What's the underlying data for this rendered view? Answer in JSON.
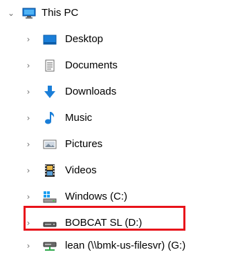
{
  "tree": {
    "root": {
      "label": "This PC",
      "icon": "monitor-icon",
      "expanded": true
    },
    "items": [
      {
        "label": "Desktop",
        "icon": "desktop-folder-icon"
      },
      {
        "label": "Documents",
        "icon": "documents-icon"
      },
      {
        "label": "Downloads",
        "icon": "download-arrow-icon"
      },
      {
        "label": "Music",
        "icon": "music-note-icon"
      },
      {
        "label": "Pictures",
        "icon": "pictures-icon"
      },
      {
        "label": "Videos",
        "icon": "film-strip-icon"
      },
      {
        "label": "Windows (C:)",
        "icon": "windows-drive-icon"
      },
      {
        "label": "BOBCAT SL (D:)",
        "icon": "removable-drive-icon",
        "highlighted": true
      },
      {
        "label": "lean (\\\\bmk-us-filesvr) (G:)",
        "icon": "network-drive-icon"
      }
    ]
  },
  "colors": {
    "highlight_border": "#e8121a",
    "chevron": "#6e6e6e",
    "accent_blue": "#1a7ed8"
  }
}
